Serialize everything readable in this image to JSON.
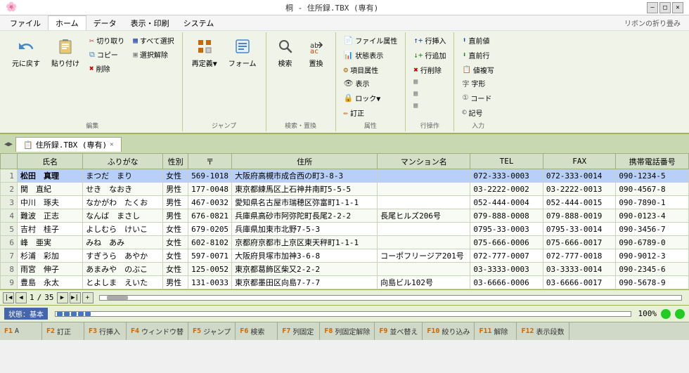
{
  "titleBar": {
    "title": "桐 - 住所録.TBX (専有)",
    "minimize": "—",
    "maximize": "□",
    "close": "✕"
  },
  "menuBar": {
    "items": [
      "ファイル",
      "ホーム",
      "データ",
      "表示・印刷",
      "システム"
    ],
    "activeIndex": 1,
    "foldLabel": "リボンの折り畳み"
  },
  "ribbon": {
    "groups": [
      {
        "label": "編集",
        "buttons": [
          {
            "id": "undo",
            "label": "元に戻す",
            "large": true
          },
          {
            "id": "paste",
            "label": "貼り付け",
            "large": true
          },
          {
            "id": "cut",
            "label": "切り取り",
            "small": true
          },
          {
            "id": "copy",
            "label": "コピー",
            "small": true
          },
          {
            "id": "delete",
            "label": "削除",
            "small": true
          },
          {
            "id": "selectall",
            "label": "すべて選択",
            "small": true
          },
          {
            "id": "deselect",
            "label": "選択解除",
            "small": true
          }
        ]
      },
      {
        "label": "ジャンプ",
        "buttons": [
          {
            "id": "redefine",
            "label": "再定義▼",
            "large": true
          },
          {
            "id": "form",
            "label": "フォーム",
            "large": true
          }
        ]
      },
      {
        "label": "検索・置換",
        "buttons": [
          {
            "id": "search",
            "label": "検索",
            "large": true
          },
          {
            "id": "replace",
            "label": "置換",
            "large": true
          }
        ]
      },
      {
        "label": "属性",
        "buttons": [
          {
            "id": "fileprop",
            "label": "ファイル属性",
            "small": true
          },
          {
            "id": "status",
            "label": "状態表示",
            "small": true
          },
          {
            "id": "itemprop",
            "label": "項目属性",
            "small": true
          },
          {
            "id": "display",
            "label": "表示",
            "small": true
          },
          {
            "id": "lock",
            "label": "ロック▼",
            "small": true
          },
          {
            "id": "edit2",
            "label": "訂正",
            "small": true
          }
        ]
      },
      {
        "label": "行操作",
        "buttons": [
          {
            "id": "rowins",
            "label": "行挿入",
            "small": true
          },
          {
            "id": "rowadd",
            "label": "行追加",
            "small": true
          },
          {
            "id": "rowdel",
            "label": "行削除",
            "small": true
          },
          {
            "id": "b1",
            "label": "",
            "small": true
          },
          {
            "id": "b2",
            "label": "",
            "small": true
          },
          {
            "id": "b3",
            "label": "",
            "small": true
          }
        ]
      },
      {
        "label": "入力",
        "buttons": [
          {
            "id": "prevrow",
            "label": "直前値",
            "small": true
          },
          {
            "id": "nextrow",
            "label": "直前行",
            "small": true
          },
          {
            "id": "copyval",
            "label": "値複写",
            "small": true
          },
          {
            "id": "wordshape",
            "label": "字形",
            "small": true
          },
          {
            "id": "code",
            "label": "コード",
            "small": true
          },
          {
            "id": "sign",
            "label": "記号",
            "small": true
          }
        ]
      }
    ]
  },
  "docTab": {
    "label": "住所録.TBX (専有)",
    "icon": "📋"
  },
  "table": {
    "columns": [
      "氏名",
      "ふりがな",
      "性別",
      "〒",
      "住所",
      "マンション名",
      "TEL",
      "FAX",
      "携帯電話番号"
    ],
    "rows": [
      {
        "num": 1,
        "name": "松田　真理",
        "kana": "まつだ　まり",
        "gender": "女性",
        "zip": "569-1018",
        "address": "大阪府高槻市成合西の町3-8-3",
        "mansion": "",
        "tel": "072-333-0003",
        "fax": "072-333-0014",
        "mobile": "090-1234-5",
        "selected": true
      },
      {
        "num": 2,
        "name": "関　直紀",
        "kana": "せき　なおき",
        "gender": "男性",
        "zip": "177-0048",
        "address": "東京都練馬区上石神井南町5-5-5",
        "mansion": "",
        "tel": "03-2222-0002",
        "fax": "03-2222-0013",
        "mobile": "090-4567-8"
      },
      {
        "num": 3,
        "name": "中川　琢夫",
        "kana": "なかがわ　たくお",
        "gender": "男性",
        "zip": "467-0032",
        "address": "愛知県名古屋市瑞穂区弥富町1-1-1",
        "mansion": "",
        "tel": "052-444-0004",
        "fax": "052-444-0015",
        "mobile": "090-7890-1"
      },
      {
        "num": 4,
        "name": "難波　正志",
        "kana": "なんば　まさし",
        "gender": "男性",
        "zip": "676-0821",
        "address": "兵庫県高砂市阿弥陀町長尾2-2-2",
        "mansion": "長尾ヒルズ206号",
        "tel": "079-888-0008",
        "fax": "079-888-0019",
        "mobile": "090-0123-4"
      },
      {
        "num": 5,
        "name": "吉村　桂子",
        "kana": "よしむら　けいこ",
        "gender": "女性",
        "zip": "679-0205",
        "address": "兵庫県加東市北野7-5-3",
        "mansion": "",
        "tel": "0795-33-0003",
        "fax": "0795-33-0014",
        "mobile": "090-3456-7"
      },
      {
        "num": 6,
        "name": "峰　亜実",
        "kana": "みね　あみ",
        "gender": "女性",
        "zip": "602-8102",
        "address": "京都府京都市上京区東天秤町1-1-1",
        "mansion": "",
        "tel": "075-666-0006",
        "fax": "075-666-0017",
        "mobile": "090-6789-0"
      },
      {
        "num": 7,
        "name": "杉浦　彩加",
        "kana": "すぎうら　あやか",
        "gender": "女性",
        "zip": "597-0071",
        "address": "大阪府貝塚市加神3-6-8",
        "mansion": "コーポフリージア201号",
        "tel": "072-777-0007",
        "fax": "072-777-0018",
        "mobile": "090-9012-3"
      },
      {
        "num": 8,
        "name": "雨宮　伸子",
        "kana": "あまみや　のぶこ",
        "gender": "女性",
        "zip": "125-0052",
        "address": "東京都葛飾区柴又2-2-2",
        "mansion": "",
        "tel": "03-3333-0003",
        "fax": "03-3333-0014",
        "mobile": "090-2345-6"
      },
      {
        "num": 9,
        "name": "豊島　永太",
        "kana": "とよしま　えいた",
        "gender": "男性",
        "zip": "131-0033",
        "address": "東京都墨田区向島7-7-7",
        "mansion": "向島ビル102号",
        "tel": "03-6666-0006",
        "fax": "03-6666-0017",
        "mobile": "090-5678-9"
      }
    ],
    "totalRows": 35
  },
  "statusBar": {
    "modeLabel": "状態：基本",
    "currentRecord": "1",
    "separator": "/",
    "totalRecords": "35",
    "zoom": "100%",
    "circle1Color": "#22cc22",
    "circle2Color": "#22cc22"
  },
  "functionKeys": [
    {
      "num": "F1",
      "label": "A"
    },
    {
      "num": "F2",
      "label": "訂正"
    },
    {
      "num": "F3",
      "label": "行挿入"
    },
    {
      "num": "F4",
      "label": "ウィンドウ替"
    },
    {
      "num": "F5",
      "label": "ジャンプ"
    },
    {
      "num": "F6",
      "label": "検索"
    },
    {
      "num": "F7",
      "label": "列固定"
    },
    {
      "num": "F8",
      "label": "列固定解除"
    },
    {
      "num": "F9",
      "label": "並べ替え"
    },
    {
      "num": "F10",
      "label": "絞り込み"
    },
    {
      "num": "F11",
      "label": "解除"
    },
    {
      "num": "F12",
      "label": "表示段数"
    }
  ]
}
